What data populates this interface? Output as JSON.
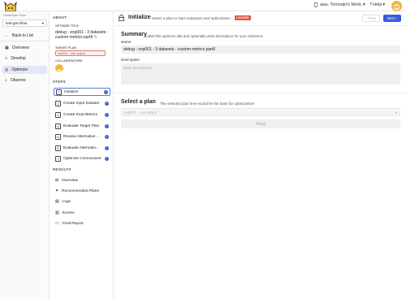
{
  "header": {
    "workspace": "aaa- Tomoaki's Work",
    "help": "Help"
  },
  "nav": {
    "flow_label": "Generation Flow",
    "flow_value": "test-gen-flow",
    "items": [
      {
        "label": "Back to List",
        "icon": "arrow-left-icon"
      },
      {
        "label": "Overview",
        "icon": "grid-icon"
      },
      {
        "label": "Develop",
        "icon": "code-icon"
      },
      {
        "label": "Optimize",
        "icon": "target-icon"
      },
      {
        "label": "Observe",
        "icon": "search-icon"
      }
    ]
  },
  "about": {
    "heading": "ABOUT",
    "title_label": "OPTIMIZE TITLE",
    "title_value": "debug - exp001 - 3 datasets - custom metrics part6",
    "target_label": "TARGET PLAN",
    "target_value": "exp001 - one output",
    "collab_label": "COLLABORATORS"
  },
  "steps": {
    "heading": "STEPS",
    "items": [
      {
        "num": "1",
        "label": "Initialize"
      },
      {
        "num": "2",
        "label": "Create Input Dataset"
      },
      {
        "num": "3",
        "label": "Create Eval Metrics"
      },
      {
        "num": "4",
        "label": "Evaluate Target Plan"
      },
      {
        "num": "5",
        "label": "Review Alternative ..."
      },
      {
        "num": "6",
        "label": "Evaluate Alternativ..."
      },
      {
        "num": "7",
        "label": "Optimize Conclusions"
      }
    ]
  },
  "results": {
    "heading": "RESULTS",
    "items": [
      {
        "label": "Overview"
      },
      {
        "label": "Recommended Plans"
      },
      {
        "label": "Logs"
      },
      {
        "label": "Scores"
      },
      {
        "label": "Final Report"
      }
    ]
  },
  "main": {
    "title": "Initialize",
    "subtitle": "Select a plan to start evaluation and optimization.",
    "locked": "LOCKED",
    "prev": "Prev",
    "next": "Next",
    "summary_title": "Summary",
    "summary_sub": "Label this optimize title and optionally write description for your reference",
    "name_label": "Name",
    "name_value": "debug - exp001 - 3 datasets - custom metrics part6",
    "desc_label": "Description",
    "desc_placeholder": "Write descriptions",
    "plan_title": "Select a plan",
    "plan_sub": "The selected plan here would be the base for optimization!",
    "plan_value": "exp001 - one output",
    "fixed": "Fixed"
  },
  "colors": {
    "accent": "#3b5bdb",
    "locked": "#e05545"
  }
}
